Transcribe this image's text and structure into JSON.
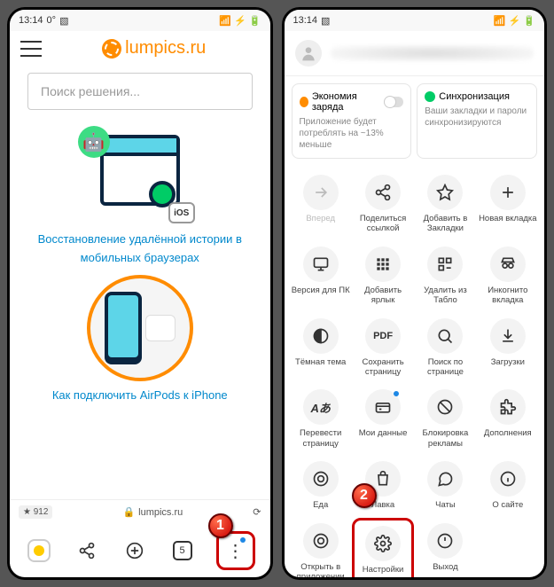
{
  "status": {
    "time": "13:14",
    "temp": "0°"
  },
  "p1": {
    "logo": "lumpics.ru",
    "search_placeholder": "Поиск решения...",
    "ios_badge": "iOS",
    "article1": "Восстановление удалённой истории в мобильных браузерах",
    "article2": "Как подключить AirPods к iPhone",
    "star_count": "★ 912",
    "lock_url": "lumpics.ru",
    "tab_count": "5",
    "badge": "1"
  },
  "p2": {
    "card1_title": "Экономия заряда",
    "card1_sub": "Приложение будет потреблять на ~13% меньше",
    "card2_title": "Синхронизация",
    "card2_sub": "Ваши закладки и пароли синхронизируются",
    "badge": "2",
    "items": [
      {
        "label": "Вперед",
        "disabled": true
      },
      {
        "label": "Поделиться ссылкой"
      },
      {
        "label": "Добавить в Закладки"
      },
      {
        "label": "Новая вкладка"
      },
      {
        "label": "Версия для ПК"
      },
      {
        "label": "Добавить ярлык"
      },
      {
        "label": "Удалить из Табло"
      },
      {
        "label": "Инкогнито вкладка"
      },
      {
        "label": "Тёмная тема"
      },
      {
        "label": "Сохранить страницу"
      },
      {
        "label": "Поиск по странице"
      },
      {
        "label": "Загрузки"
      },
      {
        "label": "Перевести страницу"
      },
      {
        "label": "Мои данные",
        "dot": true
      },
      {
        "label": "Блокировка рекламы"
      },
      {
        "label": "Дополнения"
      },
      {
        "label": "Еда"
      },
      {
        "label": "Лавка"
      },
      {
        "label": "Чаты"
      },
      {
        "label": "О сайте"
      },
      {
        "label": "Открыть в приложении"
      },
      {
        "label": "Настройки",
        "hl": true
      },
      {
        "label": "Выход"
      }
    ]
  }
}
